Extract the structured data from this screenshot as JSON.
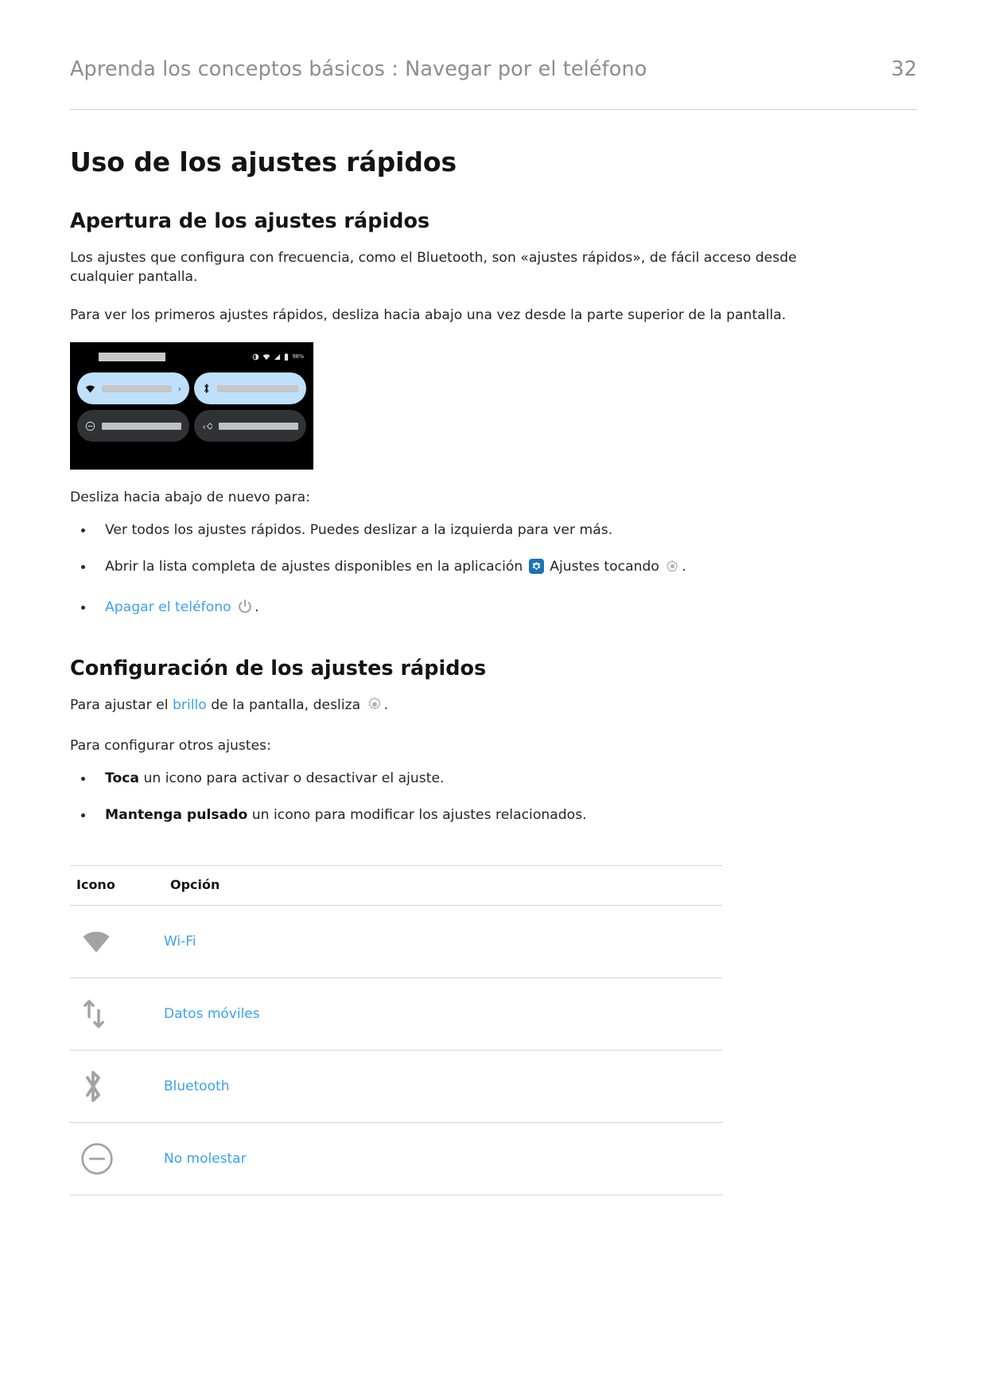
{
  "header": {
    "breadcrumb": "Aprenda los conceptos básicos : Navegar por el teléfono",
    "page_number": "32"
  },
  "doc": {
    "title": "Uso de los ajustes rápidos"
  },
  "section_open": {
    "heading": "Apertura de los ajustes rápidos",
    "para1": "Los ajustes que configura con frecuencia, como el Bluetooth, son «ajustes rápidos», de fácil acceso desde cualquier pantalla.",
    "para2": "Para ver los primeros ajustes rápidos, desliza hacia abajo una vez desde la parte superior de la pantalla.",
    "para3": "Desliza hacia abajo de nuevo para:",
    "bullet1": "Ver todos los ajustes rápidos. Puedes deslizar a la izquierda para ver más.",
    "bullet2_a": "Abrir la lista completa de ajustes disponibles en la aplicación",
    "bullet2_b": "Ajustes tocando",
    "bullet2_c": ".",
    "bullet3_link": "Apagar el teléfono",
    "bullet3_tail": "."
  },
  "phone_screenshot": {
    "battery_text": "98%",
    "tiles": [
      {
        "name": "wifi",
        "state": "on"
      },
      {
        "name": "bluetooth",
        "state": "on"
      },
      {
        "name": "do-not-disturb",
        "state": "off"
      },
      {
        "name": "auto-rotate",
        "state": "off"
      }
    ]
  },
  "section_config": {
    "heading": "Configuración de los ajustes rápidos",
    "para1_a": "Para ajustar el",
    "para1_link": "brillo",
    "para1_b": "de la pantalla, desliza",
    "para1_c": ".",
    "para2": "Para configurar otros ajustes:",
    "bullet1_bold": "Toca",
    "bullet1_rest": "un icono para activar o desactivar el ajuste.",
    "bullet2_bold": "Mantenga pulsado",
    "bullet2_rest": "un icono para modificar los ajustes relacionados."
  },
  "table": {
    "columns": [
      "Icono",
      "Opción"
    ],
    "rows": [
      {
        "icon": "wifi-icon",
        "option": "Wi-Fi"
      },
      {
        "icon": "mobile-data-icon",
        "option": "Datos móviles"
      },
      {
        "icon": "bluetooth-icon",
        "option": "Bluetooth"
      },
      {
        "icon": "do-not-disturb-icon",
        "option": "No molestar"
      }
    ]
  },
  "colors": {
    "link": "#3aa2f0",
    "header_gray": "#8d8d8d",
    "icon_gray": "#9e9e9e",
    "settings_blue": "#1a73b5",
    "tile_on": "#bfe0fb",
    "tile_off": "#303236"
  }
}
